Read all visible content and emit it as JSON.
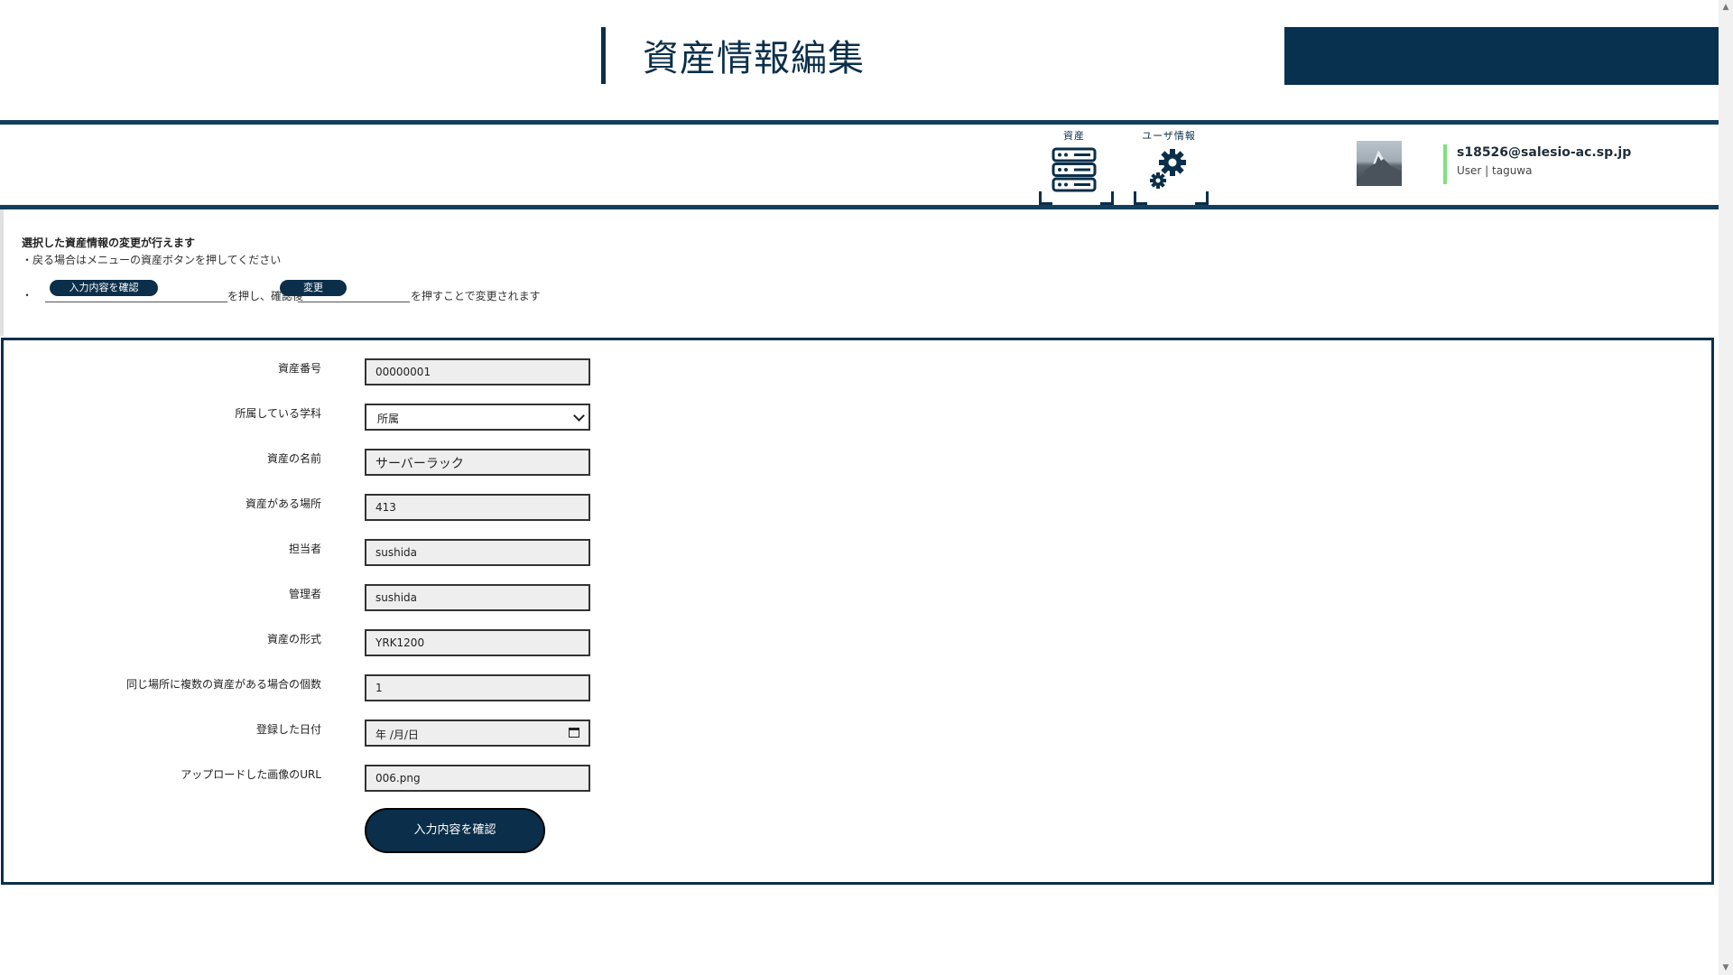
{
  "header": {
    "title": "資産情報編集"
  },
  "nav": {
    "assets_label": "資産",
    "user_info_label": "ユーザ情報"
  },
  "user": {
    "email": "s18526@salesio-ac.sp.jp",
    "role_line": "User | taguwa"
  },
  "instructions": {
    "title": "選択した資産情報の変更が行えます",
    "line2": "・戻る場合はメニューの資産ボタンを押してください",
    "bullet": "・",
    "confirm_btn_label": "入力内容を確認",
    "text_after_confirm": "を押し、確認後",
    "change_btn_label": "変更",
    "text_after_change": "を押すことで変更されます"
  },
  "form": {
    "fields": [
      {
        "label": "資産番号",
        "value": "00000001"
      },
      {
        "label": "所属している学科",
        "value": "所属"
      },
      {
        "label": "資産の名前",
        "value": "サーバーラック"
      },
      {
        "label": "資産がある場所",
        "value": "413"
      },
      {
        "label": "担当者",
        "value": "sushida"
      },
      {
        "label": "管理者",
        "value": "sushida"
      },
      {
        "label": "資産の形式",
        "value": "YRK1200"
      },
      {
        "label": "同じ場所に複数の資産がある場合の個数",
        "value": "1"
      },
      {
        "label": "登録した日付",
        "value": "年 /月/日"
      },
      {
        "label": "アップロードした画像のURL",
        "value": "006.png"
      }
    ],
    "submit_label": "入力内容を確認"
  },
  "colors": {
    "primary": "#0b2f4a",
    "accent_green": "#7fe07f"
  }
}
